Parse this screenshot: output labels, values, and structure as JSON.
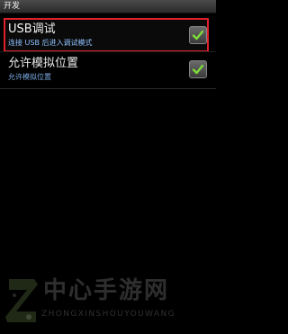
{
  "window": {
    "title": "开发"
  },
  "prefs": [
    {
      "label": "USB调试",
      "summary": "连接 USB 后进入调试模式",
      "checked": true,
      "highlight_color": "#e0202a"
    },
    {
      "label": "允许模拟位置",
      "summary": "允许模拟位置",
      "checked": true
    }
  ],
  "watermark": {
    "text": "中心手游网",
    "subtext": "ZHONGXINSHOUYOUWANG",
    "logo_icon": "zx-logo-icon"
  },
  "colors": {
    "summary_text": "#8fc1ff",
    "checkmark": "#7fdc3a",
    "background": "#000000"
  }
}
